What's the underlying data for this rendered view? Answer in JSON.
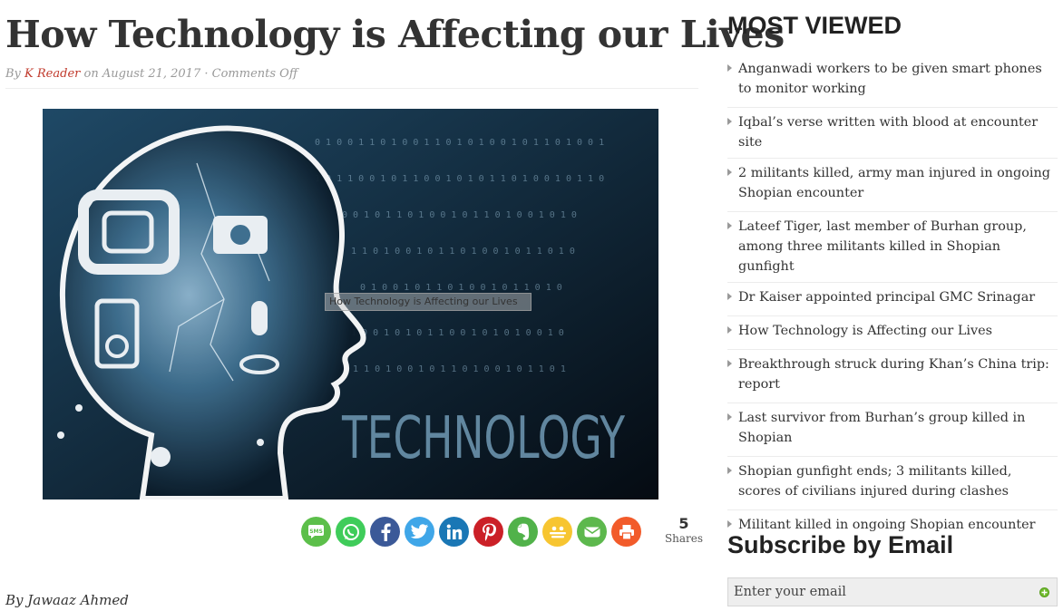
{
  "article": {
    "title": "How Technology is Affecting our Lives",
    "byline": {
      "prefix": "By",
      "author": "K Reader",
      "on": "on",
      "date": "August 21, 2017",
      "separator": "·",
      "comments": "Comments Off"
    },
    "image": {
      "tooltip": "How Technology is Affecting our Lives",
      "word": "TECHNOLOGY"
    },
    "share": {
      "buttons": [
        {
          "name": "sms",
          "color": "#5cbf4a",
          "label": "SMS"
        },
        {
          "name": "whatsapp",
          "color": "#3fcc5a"
        },
        {
          "name": "facebook",
          "color": "#3b5998"
        },
        {
          "name": "twitter",
          "color": "#3fa6e8"
        },
        {
          "name": "linkedin",
          "color": "#1a77b5"
        },
        {
          "name": "pinterest",
          "color": "#cb2027"
        },
        {
          "name": "evernote",
          "color": "#51b24a"
        },
        {
          "name": "buffer",
          "color": "#f7c531"
        },
        {
          "name": "email",
          "color": "#5db84d"
        },
        {
          "name": "print",
          "color": "#f25b2a"
        }
      ],
      "count": "5",
      "count_label": "Shares"
    },
    "author_line": "By Jawaaz Ahmed"
  },
  "sidebar": {
    "most_viewed": {
      "title": "MOST VIEWED",
      "items": [
        "Anganwadi workers to be given smart phones to monitor working",
        "Iqbal’s verse written with blood at encounter site",
        "2 militants killed, army man injured in ongoing Shopian encounter",
        "Lateef Tiger, last member of Burhan group, among three militants killed in Shopian gunfight",
        "Dr Kaiser appointed principal GMC Srinagar",
        "How Technology is Affecting our Lives",
        "Breakthrough struck during Khan’s China trip: report",
        "Last survivor from Burhan’s group killed in Shopian",
        "Shopian gunfight ends; 3 militants killed, scores of civilians injured during clashes",
        "Militant killed in ongoing Shopian encounter"
      ]
    },
    "subscribe": {
      "title": "Subscribe by Email",
      "placeholder": "Enter your email"
    }
  }
}
